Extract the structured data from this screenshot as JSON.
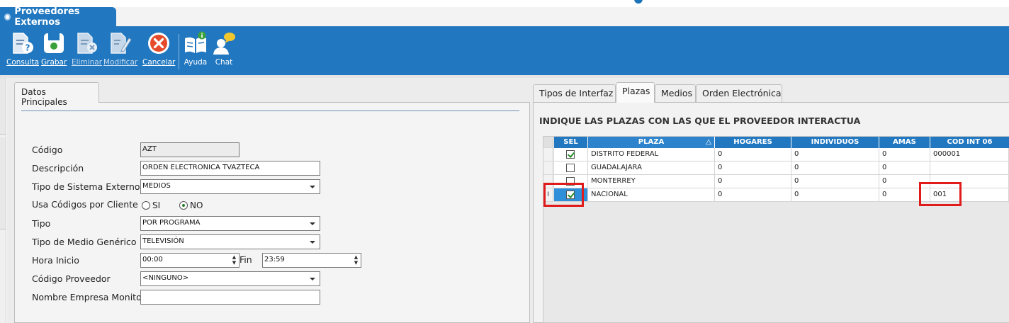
{
  "window": {
    "title": "Proveedores Externos"
  },
  "toolbar": {
    "buttons": [
      {
        "label": "Consulta",
        "icon": "document-question-icon",
        "enabled": true
      },
      {
        "label": "Grabar",
        "icon": "save-icon",
        "enabled": true
      },
      {
        "label": "Eliminar",
        "icon": "document-delete-icon",
        "enabled": false
      },
      {
        "label": "Modificar",
        "icon": "document-edit-icon",
        "enabled": false
      },
      {
        "label": "Cancelar",
        "icon": "cancel-icon",
        "enabled": true
      },
      {
        "label": "Ayuda",
        "icon": "help-book-icon",
        "enabled": true
      },
      {
        "label": "Chat",
        "icon": "chat-user-icon",
        "enabled": true
      }
    ]
  },
  "left": {
    "tab": "Datos Principales",
    "fields": {
      "codigo": {
        "label": "Código",
        "value": "AZT"
      },
      "descripcion": {
        "label": "Descripción",
        "value": "ORDEN ELECTRONICA TVAZTECA"
      },
      "tipo_sistema": {
        "label": "Tipo de Sistema Externo",
        "value": "MEDIOS"
      },
      "usa_codigos": {
        "label": "Usa Códigos por Cliente",
        "options": [
          "SI",
          "NO"
        ],
        "selected": "NO"
      },
      "tipo": {
        "label": "Tipo",
        "value": "POR PROGRAMA"
      },
      "tipo_medio": {
        "label": "Tipo de Medio Genérico",
        "value": "TELEVISIÓN"
      },
      "hora_inicio": {
        "label": "Hora Inicio",
        "value": "00:00"
      },
      "fin": {
        "label": "Fin",
        "value": "23:59"
      },
      "codigo_proveedor": {
        "label": "Código Proveedor",
        "value": "<NINGUNO>"
      },
      "nombre_empresa": {
        "label": "Nombre Empresa Monitor",
        "value": ""
      }
    }
  },
  "right": {
    "tabs": [
      "Tipos de Interfaz",
      "Plazas",
      "Medios",
      "Orden Electrónica"
    ],
    "active_tab": "Plazas",
    "heading": "INDIQUE LAS PLAZAS CON LAS QUE EL PROVEEDOR INTERACTUA",
    "grid": {
      "columns": [
        "SEL",
        "PLAZA",
        "HOGARES",
        "INDIVIDUOS",
        "AMAS",
        "COD INT 06"
      ],
      "sort_indicator": "△",
      "row_marker": "I",
      "rows": [
        {
          "sel": true,
          "plaza": "DISTRITO FEDERAL",
          "hogares": "0",
          "individuos": "0",
          "amas": "0",
          "cod": "000001"
        },
        {
          "sel": false,
          "plaza": "GUADALAJARA",
          "hogares": "0",
          "individuos": "0",
          "amas": "0",
          "cod": ""
        },
        {
          "sel": false,
          "plaza": "MONTERREY",
          "hogares": "0",
          "individuos": "0",
          "amas": "0",
          "cod": ""
        },
        {
          "sel": true,
          "plaza": "NACIONAL",
          "hogares": "0",
          "individuos": "0",
          "amas": "0",
          "cod": "001"
        }
      ]
    }
  },
  "colors": {
    "accent": "#2178c0",
    "highlight": "#e01b1b",
    "check": "#2a8a2a"
  }
}
